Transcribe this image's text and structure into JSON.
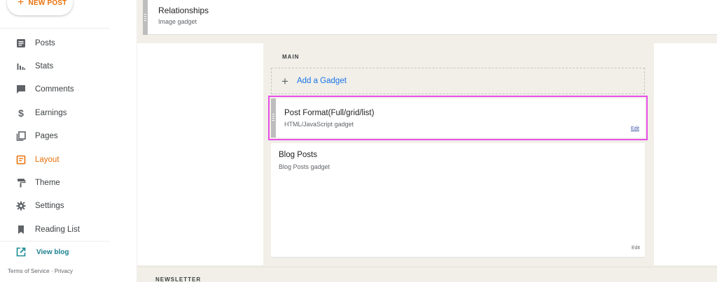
{
  "sidebar": {
    "new_post_label": "NEW POST",
    "items": [
      {
        "label": "Posts",
        "icon": "posts-icon"
      },
      {
        "label": "Stats",
        "icon": "stats-icon"
      },
      {
        "label": "Comments",
        "icon": "comments-icon"
      },
      {
        "label": "Earnings",
        "icon": "earnings-icon"
      },
      {
        "label": "Pages",
        "icon": "pages-icon"
      },
      {
        "label": "Layout",
        "icon": "layout-icon",
        "active": true
      },
      {
        "label": "Theme",
        "icon": "theme-icon"
      },
      {
        "label": "Settings",
        "icon": "settings-icon"
      },
      {
        "label": "Reading List",
        "icon": "reading-list-icon"
      }
    ],
    "view_blog_label": "View blog",
    "footer": {
      "terms": "Terms of Service",
      "separator": "·",
      "privacy": "Privacy"
    }
  },
  "layout": {
    "top_gadget": {
      "title": "Relationships",
      "subtitle": "Image gadget"
    },
    "main_section": {
      "label": "MAIN",
      "add_gadget_label": "Add a Gadget",
      "gadgets": [
        {
          "title": "Post Format(Full/grid/list)",
          "subtitle": "HTML/JavaScript gadget",
          "edit_label": "Edit",
          "highlighted": true
        },
        {
          "title": "Blog Posts",
          "subtitle": "Blog Posts gadget",
          "edit_label": "Edit"
        }
      ]
    },
    "next_section_label": "NEWSLETTER"
  },
  "colors": {
    "accent": "#e8710a",
    "link": "#1a73e8",
    "highlight": "#e84ee8",
    "canvas": "#f1efe8"
  }
}
